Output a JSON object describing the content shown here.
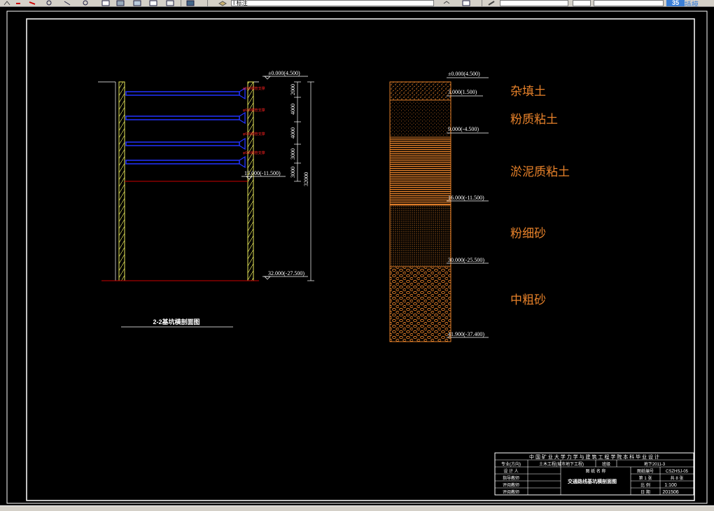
{
  "toolbar": {
    "layer_label": "Ⅰ 标注",
    "right_label": "插模"
  },
  "section": {
    "title": "2-2基坑横剖面图",
    "elev_top": "±0.000(4.500)",
    "elev_mid": "15.000(-11.500)",
    "elev_bottom": "32.000(-27.500)",
    "dims": [
      "2000",
      "4000",
      "4000",
      "3000",
      "3000"
    ],
    "dim_total": "32000",
    "strut_labels": [
      "φ609钢管支撑",
      "φ609钢管支撑",
      "φ609钢管支撑",
      "φ609钢管支撑"
    ]
  },
  "soil": {
    "elevations": [
      "±0.000(4.500)",
      "3.000(1.500)",
      "9.000(-4.500)",
      "16.000(-11.500)",
      "30.000(-25.500)",
      "41.900(-37.400)"
    ],
    "layers": [
      "杂填土",
      "粉质粘土",
      "淤泥质粘土",
      "粉细砂",
      "中粗砂"
    ]
  },
  "title_block": {
    "school": "中 国 矿 业 大 学 力 学 与 建 筑 工 程 学 院 本 科 毕 业 设 计",
    "major_label": "专业(方向)",
    "major_value": "土木工程(城市地下工程)",
    "class_label": "班级",
    "class_value": "地下2011-3",
    "designer_label": "设 计 人",
    "advisor_label": "指导教师",
    "reviewer1_label": "评阅教师",
    "reviewer2_label": "评阅教师",
    "drawing_name_label": "图 纸 名 称",
    "drawing_name": "交通路线基坑横剖面图",
    "drawing_no_label": "图纸编号",
    "drawing_no": "CSZHSJ-05",
    "sheet_label": "第 1 张",
    "sheet_total": "共 8 张",
    "scale_label": "比 例",
    "scale_value": "1:100",
    "date_label": "日 期",
    "date_value": "201506"
  }
}
